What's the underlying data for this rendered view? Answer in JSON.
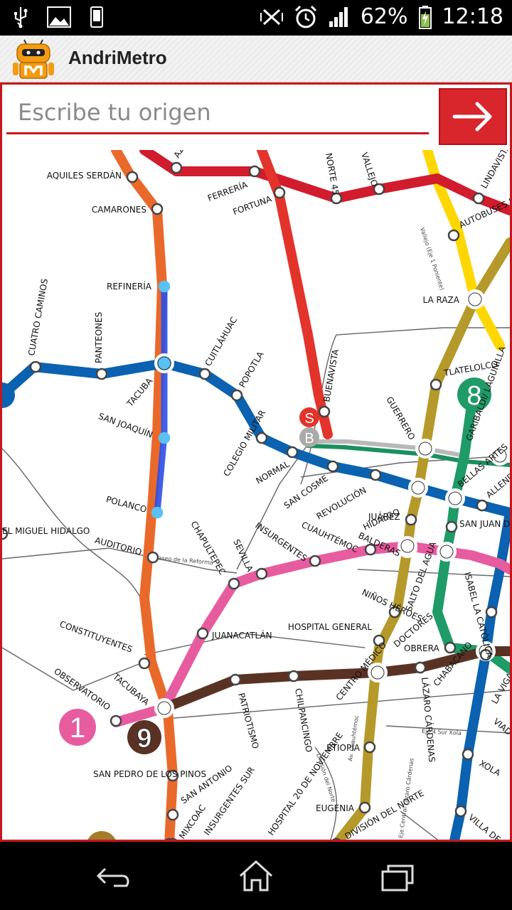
{
  "status_bar": {
    "battery": "62%",
    "time": "12:18",
    "left_icons": [
      "usb-icon",
      "image-icon",
      "phone-icon"
    ],
    "right_icons": [
      "vibrate-icon",
      "alarm-icon",
      "signal-icon",
      "battery-charging-icon"
    ]
  },
  "app": {
    "title": "AndriMetro",
    "logo_icon": "metro-robot-logo"
  },
  "search": {
    "placeholder": "Escribe tu origen",
    "go_icon": "arrow-right-icon"
  },
  "map": {
    "line_badges": [
      "1",
      "9",
      "8",
      "S",
      "B"
    ],
    "stations": [
      "AZC",
      "AQUILES SERDÁN",
      "CAMARONES",
      "FERRERÍA",
      "FORTUNA",
      "NORTE 45",
      "VALLEJO",
      "LINDAVISTA",
      "AUTOBUSES DEL NORTE",
      "LA RAZA",
      "REFINERÍA",
      "CUATRO CAMINOS",
      "PANTEONES",
      "TACUBA",
      "CUITLÁHUAC",
      "POPOTLA",
      "BUENAVISTA",
      "TLATELOLCO",
      "GARIBALDI/ LAGUNILLA",
      "GUERRERO",
      "SAN JOAQUÍN",
      "COLEGIO MILITAR",
      "NORMAL",
      "SAN COSME",
      "REVOLUCIÓN",
      "HIDALGO",
      "JUÁREZ",
      "BALDERAS",
      "BELLAS ARTES",
      "ALLENDE",
      "SAN JUAN DE LETRÁN",
      "POLANCO",
      "AUDITORIO",
      "CHAPULTEPEC",
      "SEVILLA",
      "INSURGENTES",
      "CUAUHTÉMOC",
      "SALTO DEL AGUA",
      "ISABEL LA CATÓLICA",
      "NIÑOS HÉROES",
      "HOSPITAL GENERAL",
      "DOCTORES",
      "OBRERA",
      "CONSTITUYENTES",
      "JUANACATLÁN",
      "OBSERVATORIO",
      "TACUBAYA",
      "PATRIOTISMO",
      "CHILPANCINGO",
      "CENTRO MÉDICO",
      "LÁZARO CÁRDENAS",
      "CHABACANO",
      "LA VIGA",
      "VIADUCTO",
      "XOLA",
      "ETIOPÍA",
      "SAN PEDRO DE LOS PINOS",
      "SAN ANTONIO",
      "MIXCOAC",
      "INSURGENTES SUR",
      "HOSPITAL 20 DE NOVIEMBRE",
      "EUGENIA",
      "DIVISIÓN DEL NORTE",
      "VILLA DE CORTÉS",
      "EL MIGUEL HIDALGO"
    ],
    "street_labels": [
      "Paseo de la Reforma",
      "Vallejo (Eje 1 Poniente)",
      "Eje 4 Sur Xola",
      "Av. Cuauhtémoc",
      "División del Norte",
      "Eje Central Lázaro Cárdenas"
    ]
  },
  "nav_bar": {
    "back_icon": "back-icon",
    "home_icon": "home-icon",
    "recents_icon": "recents-icon"
  }
}
